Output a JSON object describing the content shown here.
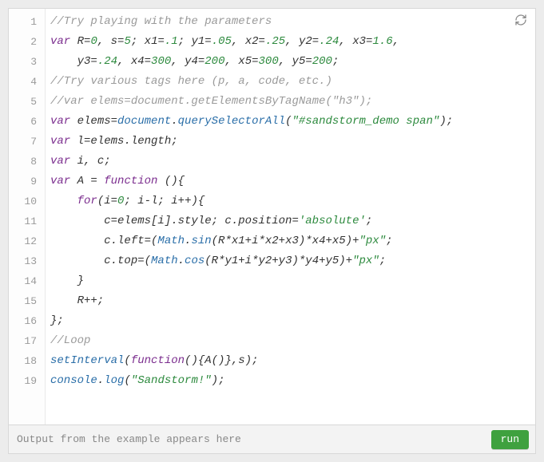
{
  "editor": {
    "refresh_label": "refresh",
    "line_numbers": [
      "1",
      "2",
      "3",
      "4",
      "5",
      "6",
      "7",
      "8",
      "9",
      "10",
      "11",
      "12",
      "13",
      "14",
      "15",
      "16",
      "17",
      "18",
      "19"
    ],
    "code_lines": [
      [
        {
          "cls": "c-comment",
          "text": "//Try playing with the parameters"
        }
      ],
      [
        {
          "cls": "c-keyword",
          "text": "var"
        },
        {
          "cls": "c-ident",
          "text": " R="
        },
        {
          "cls": "c-num",
          "text": "0"
        },
        {
          "cls": "c-ident",
          "text": ", s="
        },
        {
          "cls": "c-num",
          "text": "5"
        },
        {
          "cls": "c-ident",
          "text": "; x1="
        },
        {
          "cls": "c-num",
          "text": ".1"
        },
        {
          "cls": "c-ident",
          "text": "; y1="
        },
        {
          "cls": "c-num",
          "text": ".05"
        },
        {
          "cls": "c-ident",
          "text": ", x2="
        },
        {
          "cls": "c-num",
          "text": ".25"
        },
        {
          "cls": "c-ident",
          "text": ", y2="
        },
        {
          "cls": "c-num",
          "text": ".24"
        },
        {
          "cls": "c-ident",
          "text": ", x3="
        },
        {
          "cls": "c-num",
          "text": "1.6"
        },
        {
          "cls": "c-ident",
          "text": ","
        }
      ],
      [
        {
          "cls": "c-ident",
          "text": "    y3="
        },
        {
          "cls": "c-num",
          "text": ".24"
        },
        {
          "cls": "c-ident",
          "text": ", x4="
        },
        {
          "cls": "c-num",
          "text": "300"
        },
        {
          "cls": "c-ident",
          "text": ", y4="
        },
        {
          "cls": "c-num",
          "text": "200"
        },
        {
          "cls": "c-ident",
          "text": ", x5="
        },
        {
          "cls": "c-num",
          "text": "300"
        },
        {
          "cls": "c-ident",
          "text": ", y5="
        },
        {
          "cls": "c-num",
          "text": "200"
        },
        {
          "cls": "c-ident",
          "text": ";"
        }
      ],
      [
        {
          "cls": "c-comment",
          "text": "//Try various tags here (p, a, code, etc.)"
        }
      ],
      [
        {
          "cls": "c-comment",
          "text": "//var elems=document.getElementsByTagName(\"h3\");"
        }
      ],
      [
        {
          "cls": "c-keyword",
          "text": "var"
        },
        {
          "cls": "c-ident",
          "text": " elems="
        },
        {
          "cls": "c-func",
          "text": "document"
        },
        {
          "cls": "c-ident",
          "text": "."
        },
        {
          "cls": "c-func",
          "text": "querySelectorAll"
        },
        {
          "cls": "c-ident",
          "text": "("
        },
        {
          "cls": "c-string",
          "text": "\"#sandstorm_demo span\""
        },
        {
          "cls": "c-ident",
          "text": ");"
        }
      ],
      [
        {
          "cls": "c-keyword",
          "text": "var"
        },
        {
          "cls": "c-ident",
          "text": " l=elems.length;"
        }
      ],
      [
        {
          "cls": "c-keyword",
          "text": "var"
        },
        {
          "cls": "c-ident",
          "text": " i, c;"
        }
      ],
      [
        {
          "cls": "c-keyword",
          "text": "var"
        },
        {
          "cls": "c-ident",
          "text": " A = "
        },
        {
          "cls": "c-keyword",
          "text": "function"
        },
        {
          "cls": "c-ident",
          "text": " (){"
        }
      ],
      [
        {
          "cls": "c-ident",
          "text": "    "
        },
        {
          "cls": "c-keyword",
          "text": "for"
        },
        {
          "cls": "c-ident",
          "text": "(i="
        },
        {
          "cls": "c-num",
          "text": "0"
        },
        {
          "cls": "c-ident",
          "text": "; i-l; i++){"
        }
      ],
      [
        {
          "cls": "c-ident",
          "text": "        c=elems[i].style; c.position="
        },
        {
          "cls": "c-string",
          "text": "'absolute'"
        },
        {
          "cls": "c-ident",
          "text": ";"
        }
      ],
      [
        {
          "cls": "c-ident",
          "text": "        c.left=("
        },
        {
          "cls": "c-func",
          "text": "Math"
        },
        {
          "cls": "c-ident",
          "text": "."
        },
        {
          "cls": "c-func",
          "text": "sin"
        },
        {
          "cls": "c-ident",
          "text": "(R*x1+i*x2+x3)*x4+x5)+"
        },
        {
          "cls": "c-string",
          "text": "\"px\""
        },
        {
          "cls": "c-ident",
          "text": ";"
        }
      ],
      [
        {
          "cls": "c-ident",
          "text": "        c.top=("
        },
        {
          "cls": "c-func",
          "text": "Math"
        },
        {
          "cls": "c-ident",
          "text": "."
        },
        {
          "cls": "c-func",
          "text": "cos"
        },
        {
          "cls": "c-ident",
          "text": "(R*y1+i*y2+y3)*y4+y5)+"
        },
        {
          "cls": "c-string",
          "text": "\"px\""
        },
        {
          "cls": "c-ident",
          "text": ";"
        }
      ],
      [
        {
          "cls": "c-ident",
          "text": "    }"
        }
      ],
      [
        {
          "cls": "c-ident",
          "text": "    R++;"
        }
      ],
      [
        {
          "cls": "c-ident",
          "text": "};"
        }
      ],
      [
        {
          "cls": "c-comment",
          "text": "//Loop"
        }
      ],
      [
        {
          "cls": "c-func",
          "text": "setInterval"
        },
        {
          "cls": "c-ident",
          "text": "("
        },
        {
          "cls": "c-keyword",
          "text": "function"
        },
        {
          "cls": "c-ident",
          "text": "(){A()},s);"
        }
      ],
      [
        {
          "cls": "c-func",
          "text": "console"
        },
        {
          "cls": "c-ident",
          "text": "."
        },
        {
          "cls": "c-func",
          "text": "log"
        },
        {
          "cls": "c-ident",
          "text": "("
        },
        {
          "cls": "c-string",
          "text": "\"Sandstorm!\""
        },
        {
          "cls": "c-ident",
          "text": ");"
        }
      ]
    ]
  },
  "output": {
    "placeholder": "Output from the example appears here",
    "run_label": "run"
  },
  "colors": {
    "run_button": "#3fa13f"
  }
}
